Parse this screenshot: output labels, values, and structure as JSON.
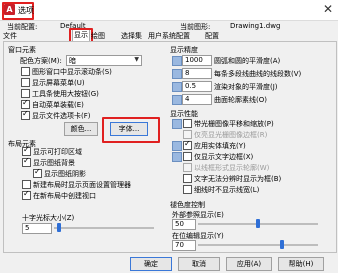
{
  "window": {
    "title": "选项",
    "close_glyph": "✕",
    "app_icon_letter": "A"
  },
  "header": {
    "current_profile_label": "当前配置:",
    "current_profile_value": "Default",
    "current_drawing_label": "当前图形:",
    "current_drawing_value": "Drawing1.dwg"
  },
  "tabs": [
    "文件",
    "显示",
    "打开和保存",
    "打印和发布",
    "系统",
    "用户系统配置",
    "绘图",
    "三维建模",
    "选择集",
    "配置"
  ],
  "window_elements": {
    "title": "窗口元素",
    "color_scheme_label": "配色方案(M):",
    "color_scheme_value": "暗",
    "checkboxes": [
      {
        "label": "图形窗口中显示滚动条(S)",
        "checked": false
      },
      {
        "label": "显示屏幕菜单(U)",
        "checked": false
      },
      {
        "label": "工具条使用大按钮(G)",
        "checked": false
      },
      {
        "label": "自动菜单装载(E)",
        "checked": true
      },
      {
        "label": "显示文件选项卡(F)",
        "checked": true
      }
    ],
    "colors_button": "颜色...",
    "fonts_button": "字体..."
  },
  "layout_elements": {
    "title": "布局元素",
    "checkboxes": [
      {
        "label": "显示可打印区域",
        "checked": true
      },
      {
        "label": "显示图纸背景",
        "checked": true
      },
      {
        "label": "显示图纸阴影",
        "checked": true
      },
      {
        "label": "新建布局时显示页面设置管理器",
        "checked": false
      },
      {
        "label": "在新布局中创建视口",
        "checked": true
      }
    ]
  },
  "crosshair": {
    "title": "十字光标大小(Z)",
    "value": "5",
    "level_fraction": 0.05
  },
  "display_resolution": {
    "title": "显示精度",
    "rows": [
      {
        "value": "1000",
        "label": "圆弧和圆的平滑度(A)"
      },
      {
        "value": "8",
        "label": "每条多段线曲线的线段数(V)"
      },
      {
        "value": "0.5",
        "label": "渲染对象的平滑度(J)"
      },
      {
        "value": "4",
        "label": "曲面轮廓素线(O)"
      }
    ]
  },
  "display_performance": {
    "title": "显示性能",
    "checkboxes": [
      {
        "label": "带光栅图像平移和缩放(P)",
        "checked": false,
        "disabled": false
      },
      {
        "label": "仅亮显光栅图像边框(R)",
        "checked": false,
        "disabled": true
      },
      {
        "label": "应用实体填充(Y)",
        "checked": true,
        "disabled": false
      },
      {
        "label": "仅显示文字边框(X)",
        "checked": false,
        "disabled": false
      },
      {
        "label": "以线框形式显示轮廓(W)",
        "checked": false,
        "disabled": true
      },
      {
        "label": "文字无法分辨时显示为框(B)",
        "checked": false,
        "disabled": false
      },
      {
        "label": "细线时不显示线宽(L)",
        "checked": false,
        "disabled": false
      }
    ]
  },
  "fade_control": {
    "title": "褪色度控制",
    "xref_label": "外部参照显示(E)",
    "xref_value": "50",
    "xref_fraction": 0.5,
    "inplace_label": "在位编辑显示(Y)",
    "inplace_value": "70",
    "inplace_fraction": 0.7
  },
  "buttons": {
    "ok": "确定",
    "cancel": "取消",
    "apply": "应用(A)",
    "help": "帮助(H)"
  },
  "colors": {
    "highlight": "#e02020",
    "accent": "#2f6fd6"
  }
}
